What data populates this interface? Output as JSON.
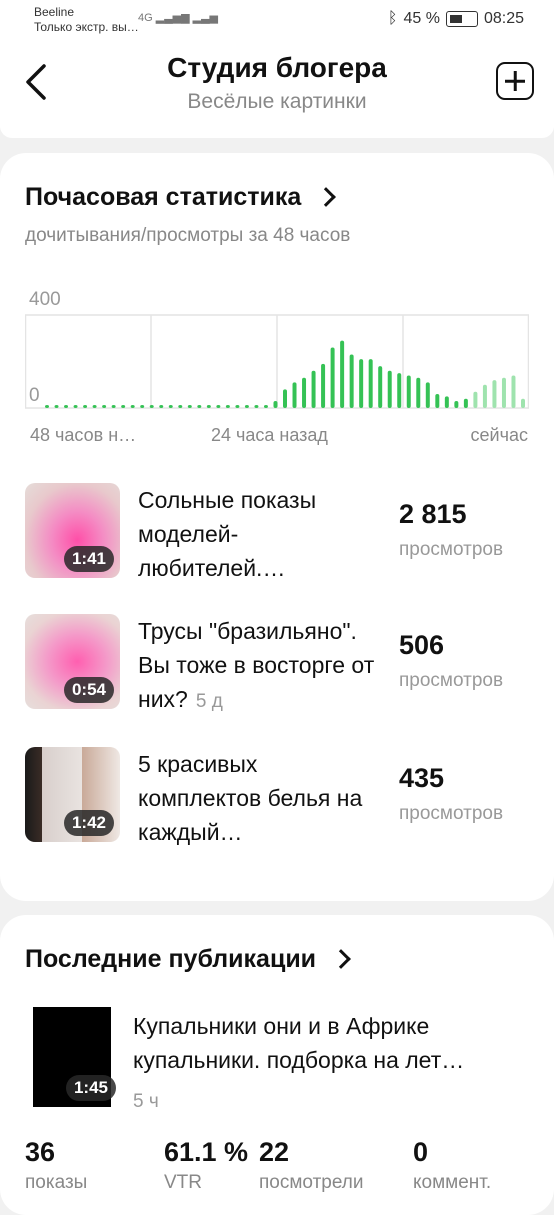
{
  "status": {
    "carrier": "Beeline",
    "carrier_sub": "Только экстр. вы…",
    "network": "4G",
    "battery": "45 %",
    "time": "08:25"
  },
  "header": {
    "title": "Студия блогера",
    "subtitle": "Весёлые картинки"
  },
  "stats": {
    "title": "Почасовая статистика",
    "subtitle": "дочитывания/просмотры за 48 часов",
    "chart_data": {
      "type": "bar",
      "y_ticks": [
        "400",
        "0"
      ],
      "ylim": [
        0,
        400
      ],
      "x_labels": [
        "48 часов н…",
        "24 часа назад",
        "сейчас"
      ],
      "values": [
        12,
        12,
        12,
        12,
        12,
        12,
        12,
        12,
        12,
        12,
        12,
        12,
        12,
        12,
        12,
        12,
        12,
        12,
        12,
        12,
        12,
        12,
        12,
        12,
        30,
        80,
        110,
        130,
        160,
        190,
        260,
        290,
        230,
        210,
        210,
        180,
        160,
        150,
        140,
        130,
        110,
        60,
        50,
        30,
        40,
        70,
        100,
        120,
        130,
        140,
        40
      ],
      "colors": {
        "main": "#35c255",
        "light": "#9fe3ae",
        "grid": "#e4e4e4"
      }
    }
  },
  "items": [
    {
      "title": "Сольные показы моделей-любителей.…",
      "duration": "1:41",
      "count": "2 815",
      "unit": "просмотров",
      "age": ""
    },
    {
      "title": "Трусы \"бразильяно\". Вы тоже в восторге от них?",
      "duration": "0:54",
      "count": "506",
      "unit": "просмотров",
      "age": "5 д"
    },
    {
      "title": "5 красивых комплектов белья на каждый…",
      "duration": "1:42",
      "count": "435",
      "unit": "просмотров",
      "age": ""
    }
  ],
  "recent": {
    "title": "Последние публикации",
    "post_title": "Купальники они и в Африке купальники. подборка на лет…",
    "post_duration": "1:45",
    "post_age": "5 ч",
    "metrics": [
      {
        "value": "36",
        "label": "показы"
      },
      {
        "value": "61.1 %",
        "label": "VTR"
      },
      {
        "value": "22",
        "label": "посмотрели"
      },
      {
        "value": "0",
        "label": "коммент."
      }
    ]
  }
}
